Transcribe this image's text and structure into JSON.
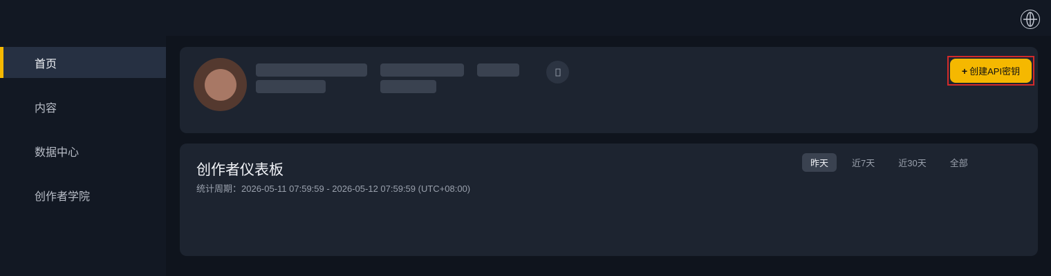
{
  "sidebar": {
    "items": [
      {
        "label": "首页",
        "active": true
      },
      {
        "label": "内容",
        "active": false
      },
      {
        "label": "数据中心",
        "active": false
      },
      {
        "label": "创作者学院",
        "active": false
      }
    ]
  },
  "header": {
    "language_icon": "globe-icon"
  },
  "profile": {
    "api_button_plus": "+",
    "api_button_label": "创建API密钥",
    "info_icon": "info-icon"
  },
  "dashboard": {
    "title": "创作者仪表板",
    "period": "统计周期：2026-05-11 07:59:59 - 2026-05-12 07:59:59 (UTC+08:00)",
    "tabs": [
      {
        "label": "昨天",
        "active": true
      },
      {
        "label": "近7天",
        "active": false
      },
      {
        "label": "近30天",
        "active": false
      },
      {
        "label": "全部",
        "active": false
      }
    ]
  },
  "colors": {
    "accent": "#f5b800",
    "highlight_outline": "#d42a2a",
    "background": "#0f141d",
    "card": "#1d2430"
  }
}
